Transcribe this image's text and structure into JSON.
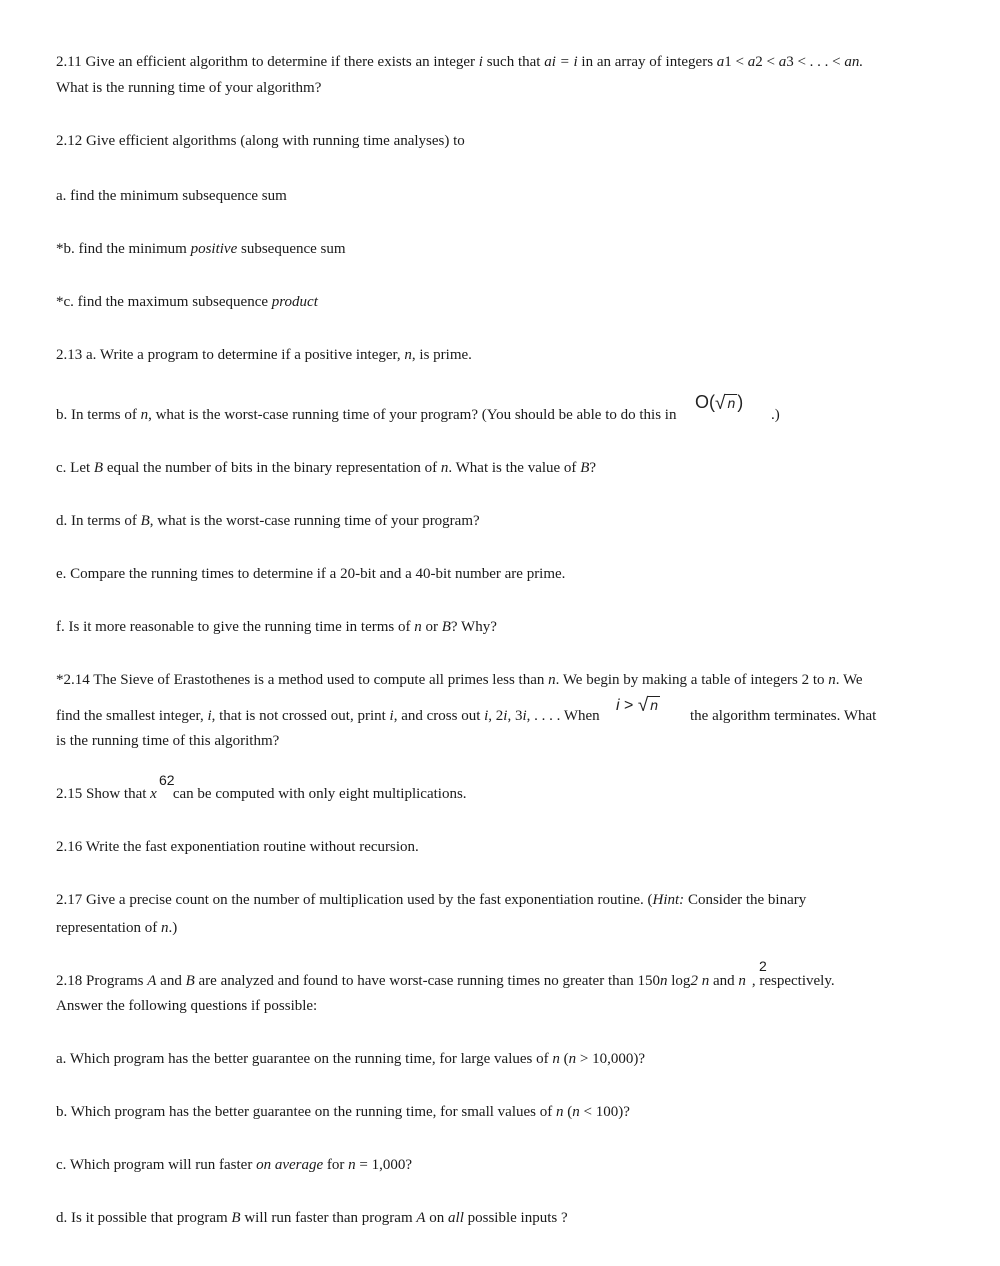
{
  "problems": {
    "p211": {
      "lead": "2.11 Give an efficient algorithm to determine if there exists an integer ",
      "var_i": "i",
      "mid1": " such that ",
      "eq": "ai = i",
      "mid2": " in an array of integers ",
      "seq": "a",
      "seq_rest": "1 < ",
      "seq2": "a",
      "seq2_rest": "2 < ",
      "seq3": "a",
      "seq3_rest": "3 < . . . < ",
      "seq_end": "an.",
      "line2": "What is the running time of your algorithm?"
    },
    "p212": {
      "head": "2.12 Give efficient algorithms (along with running time analyses) to",
      "a": "a. find the minimum subsequence sum",
      "b_lead": "*b. find the minimum ",
      "b_em": "positive",
      "b_tail": " subsequence sum",
      "c_lead": "*c. find the maximum subsequence ",
      "c_em": "product"
    },
    "p213": {
      "a_lead": "2.13 a. Write a program to determine if a positive integer, ",
      "a_var": "n",
      "a_tail": ", is prime.",
      "b_lead": "b. In terms of ",
      "b_var": "n",
      "b_tail": ", what is the worst-case running time of your program? (You should be able to do this in",
      "b_big_o": "O(",
      "b_sqrt_n": "n",
      "b_close": ")",
      "b_end": ".)",
      "c_lead": "c. Let ",
      "c_var": "B",
      "c_mid": " equal the number of bits in the binary representation of ",
      "c_var2": "n",
      "c_mid2": ". What is the value of ",
      "c_var3": "B",
      "c_end": "?",
      "d_lead": "d. In terms of ",
      "d_var": "B",
      "d_tail": ", what is the worst-case running time of your program?",
      "e": "e. Compare the running times to determine if a 20-bit and a 40-bit number are prime.",
      "f_lead": "f. Is it more reasonable to give the running time in terms of ",
      "f_var": "n",
      "f_mid": " or ",
      "f_var2": "B",
      "f_end": "? Why?"
    },
    "p214": {
      "l1_lead": "*2.14 The Sieve of Erastothenes is a method used to compute all primes less than ",
      "l1_var": "n",
      "l1_mid": ". We begin by making a table of integers 2 to ",
      "l1_var2": "n",
      "l1_end": ". We",
      "l2_lead": "find the smallest integer, ",
      "l2_var": "i",
      "l2_mid": ", that is not crossed out, print ",
      "l2_var2": "i",
      "l2_mid2": ", and cross out ",
      "l2_var3": "i",
      "l2_sep": ", 2",
      "l2_var4": "i",
      "l2_sep2": ", 3",
      "l2_var5": "i",
      "l2_mid3": ", . . . . When",
      "l2_math_i": "i",
      "l2_math_gt": ">",
      "l2_math_n": "n",
      "l2_end": "the algorithm terminates. What",
      "l3": "is the running time of this algorithm?"
    },
    "p215": {
      "exp": "62",
      "lead": "2.15 Show that ",
      "var": "x",
      "tail": "can be computed with only eight multiplications."
    },
    "p216": {
      "text": "2.16 Write the fast exponentiation routine without recursion."
    },
    "p217": {
      "l1_lead": "2.17 Give a precise count on the number of multiplication used by the fast exponentiation routine. (",
      "l1_hint": "Hint:",
      "l1_tail": " Consider the binary",
      "l2_lead": "representation of ",
      "l2_var": "n",
      "l2_end": ".)"
    },
    "p218": {
      "exp": "2",
      "l1_lead": "2.18 Programs ",
      "l1_A": "A",
      "l1_mid": " and ",
      "l1_B": "B",
      "l1_mid2": " are analyzed and found to have worst-case running times no greater than 150",
      "l1_n": "n",
      "l1_log": " log",
      "l1_two": "2 ",
      "l1_n2": "n",
      "l1_and": " and ",
      "l1_n3": "n",
      "l1_end": ", respectively.",
      "l2": "Answer the following questions if possible:",
      "a_lead": "a. Which program has the better guarantee on the running time, for large values of ",
      "a_var": "n",
      "a_paren": " (",
      "a_var2": "n",
      "a_end": " > 10,000)?",
      "b_lead": "b. Which program has the better guarantee on the running time, for small values of ",
      "b_var": "n",
      "b_paren": " (",
      "b_var2": "n",
      "b_end": " < 100)?",
      "c_lead": "c. Which program will run faster ",
      "c_em": "on average",
      "c_mid": " for ",
      "c_var": "n",
      "c_end": " = 1,000?",
      "d_lead": "d. Is it possible that program ",
      "d_B": "B",
      "d_mid": " will run faster than program ",
      "d_A": "A",
      "d_mid2": " on ",
      "d_all": "all",
      "d_end": " possible inputs ?"
    }
  }
}
